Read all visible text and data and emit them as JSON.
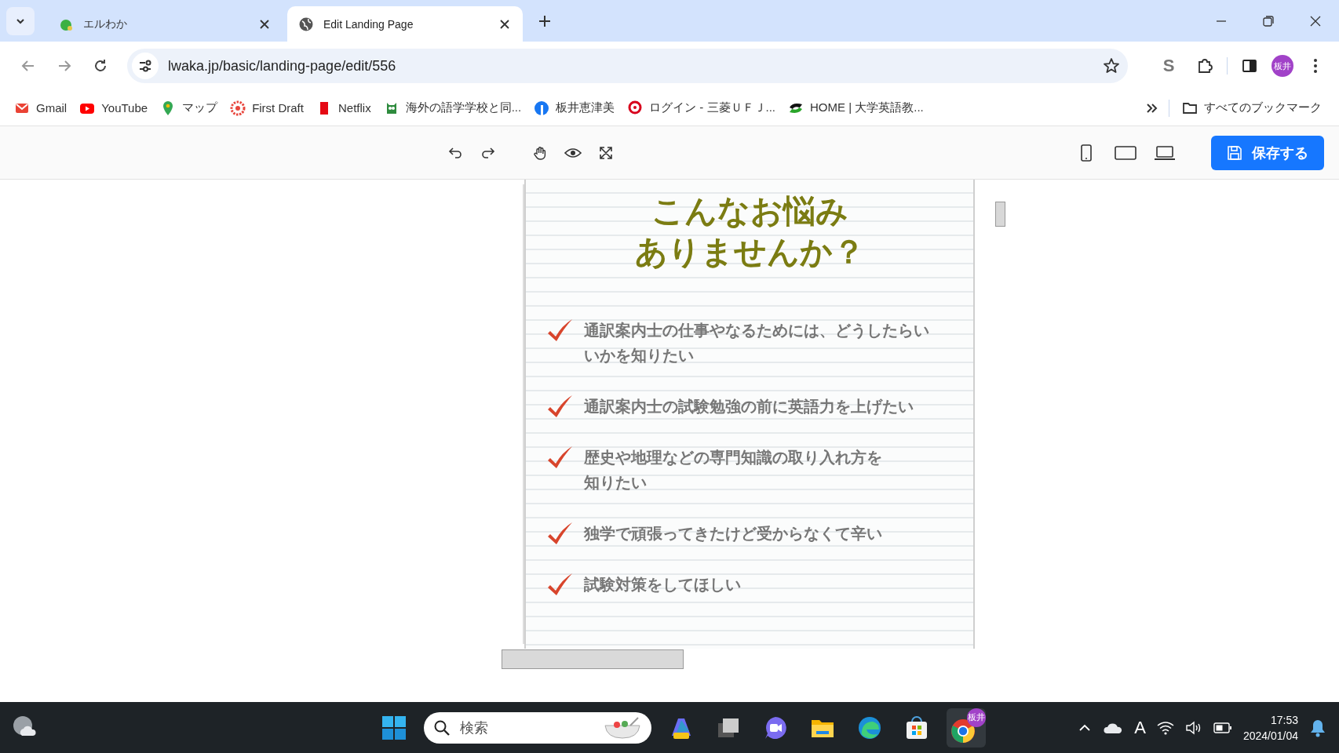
{
  "browser": {
    "tabs": [
      {
        "title": "エルわか",
        "selected": false
      },
      {
        "title": "Edit Landing Page",
        "selected": true
      }
    ],
    "url": "lwaka.jp/basic/landing-page/edit/556",
    "extension_label": "S",
    "profile": "板井",
    "bookmarks": [
      {
        "label": "Gmail"
      },
      {
        "label": "YouTube"
      },
      {
        "label": "マップ"
      },
      {
        "label": "First Draft"
      },
      {
        "label": "Netflix"
      },
      {
        "label": "海外の語学学校と同..."
      },
      {
        "label": "板井恵津美"
      },
      {
        "label": "ログイン - 三菱ＵＦＪ..."
      },
      {
        "label": "HOME | 大学英語教..."
      }
    ],
    "all_bookmarks": "すべてのブックマーク"
  },
  "editor": {
    "save_button": "保存する"
  },
  "page": {
    "heading": [
      "こんなお悩み",
      "ありませんか？"
    ],
    "items": [
      {
        "lines": [
          "通訳案内士の仕事やなるためには、どうしたらいいかを知りたい"
        ]
      },
      {
        "lines": [
          "通訳案内士の試験勉強の前に英語力を上げたい"
        ]
      },
      {
        "lines": [
          "歴史や地理などの専門知識の取り入れ方を",
          "知りたい"
        ]
      },
      {
        "lines": [
          "独学で頑張ってきたけど受からなくて辛い"
        ]
      },
      {
        "lines": [
          "試験対策をしてほしい"
        ]
      }
    ]
  },
  "taskbar": {
    "search_placeholder": "検索",
    "app_badge": "板井",
    "ime": "A",
    "time": "17:53",
    "date": "2024/01/04"
  }
}
